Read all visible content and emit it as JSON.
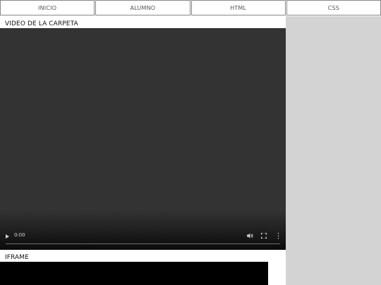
{
  "nav": {
    "items": [
      {
        "label": "INICIO"
      },
      {
        "label": "ALUMNO"
      },
      {
        "label": "HTML"
      },
      {
        "label": "CSS"
      }
    ]
  },
  "main": {
    "video_title": "VIDEO DE LA CARPETA",
    "iframe_title": "IFRAME"
  },
  "video_player": {
    "current_time": "0:00",
    "progress": 0,
    "icons": [
      "play-icon",
      "volume-icon",
      "fullscreen-icon",
      "more-options-icon"
    ]
  },
  "colors": {
    "sidebar": "#d3d3d3",
    "video_bg": "#333333",
    "iframe_bg": "#000000",
    "nav_border": "#888888"
  }
}
